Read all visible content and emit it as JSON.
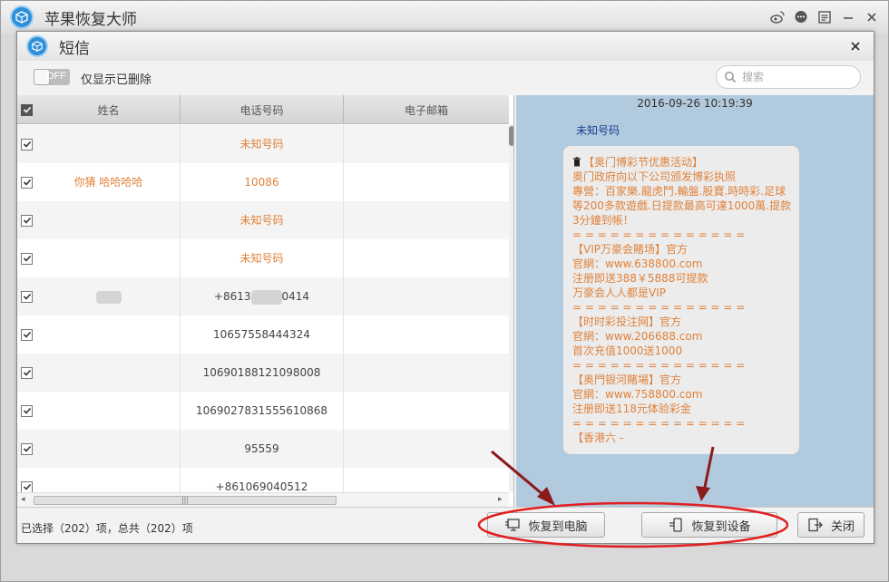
{
  "app": {
    "title": "苹果恢复大师"
  },
  "window_controls": [
    "weibo-icon",
    "chat-icon",
    "menu-icon",
    "minimize-icon",
    "close-icon"
  ],
  "dialog": {
    "title": "短信"
  },
  "toolbar": {
    "toggle_state": "OFF",
    "toggle_label": "仅显示已删除",
    "search_placeholder": "搜索"
  },
  "table": {
    "columns": [
      "姓名",
      "电话号码",
      "电子邮箱"
    ],
    "rows": [
      {
        "name": "",
        "phone": "未知号码",
        "email": "",
        "highlight": true,
        "checked": true
      },
      {
        "name": "你猜 ￼哈哈哈哈",
        "phone": "10086",
        "email": "",
        "highlight": true,
        "checked": true
      },
      {
        "name": "",
        "phone": "未知号码",
        "email": "",
        "highlight": true,
        "checked": true
      },
      {
        "name": "",
        "phone": "未知号码",
        "email": "",
        "highlight": true,
        "checked": true
      },
      {
        "name": "",
        "phone": "+8613",
        "phone_tail": "0414",
        "email": "",
        "highlight": false,
        "checked": true,
        "blurred": true
      },
      {
        "name": "",
        "phone": "10657558444324",
        "email": "",
        "highlight": false,
        "checked": true
      },
      {
        "name": "",
        "phone": "10690188121098008",
        "email": "",
        "highlight": false,
        "checked": true
      },
      {
        "name": "",
        "phone": "1069027831555610868",
        "email": "",
        "highlight": false,
        "checked": true
      },
      {
        "name": "",
        "phone": "95559",
        "email": "",
        "highlight": false,
        "checked": true
      },
      {
        "name": "",
        "phone": "+861069040512",
        "email": "",
        "highlight": false,
        "checked": true
      }
    ]
  },
  "message": {
    "timestamp": "2016-09-26 10:19:39",
    "sender": "未知号码",
    "lines": [
      "￼【奥门博彩节优惠活动】￼",
      "￼奥门政府向以下公司颁发博彩执照",
      "￼專營：百家樂.龍虎鬥.輪盤.股寶.時時彩.足球等200多款遊戲.日提款最高可達1000萬.提款3分鐘到帳！",
      "= = = = = = = = = = = = = =",
      "￼【VIP万豪会賭场】官方",
      "￼官網：www.638800.com",
      "￼注册即送388￥5888可提款",
      "￼万豪会人人都是VIP",
      "= = = = = = = = = = = = = =",
      "￼【时时彩投注网】官方",
      "￼官網：www.206688.com",
      "￼首次充值1000送1000",
      "= = = = = = = = = = = = = =",
      "￼【奥門银河賭場】官方",
      "￼官網：www.758800.com",
      "￼注册即送118元体验彩金",
      "= = = = = = = = = = = = = =",
      "￼【香港六 -"
    ]
  },
  "footer": {
    "status": "已选择（202）项，总共（202）项",
    "restore_pc": "恢复到电脑",
    "restore_device": "恢复到设备",
    "close": "关闭"
  },
  "colors": {
    "accent_orange": "#e0823a",
    "message_bg": "#b2cadd",
    "sender_blue": "#1c3f94",
    "annotation_red": "#e02020",
    "arrow_dark": "#8b1a1a"
  }
}
